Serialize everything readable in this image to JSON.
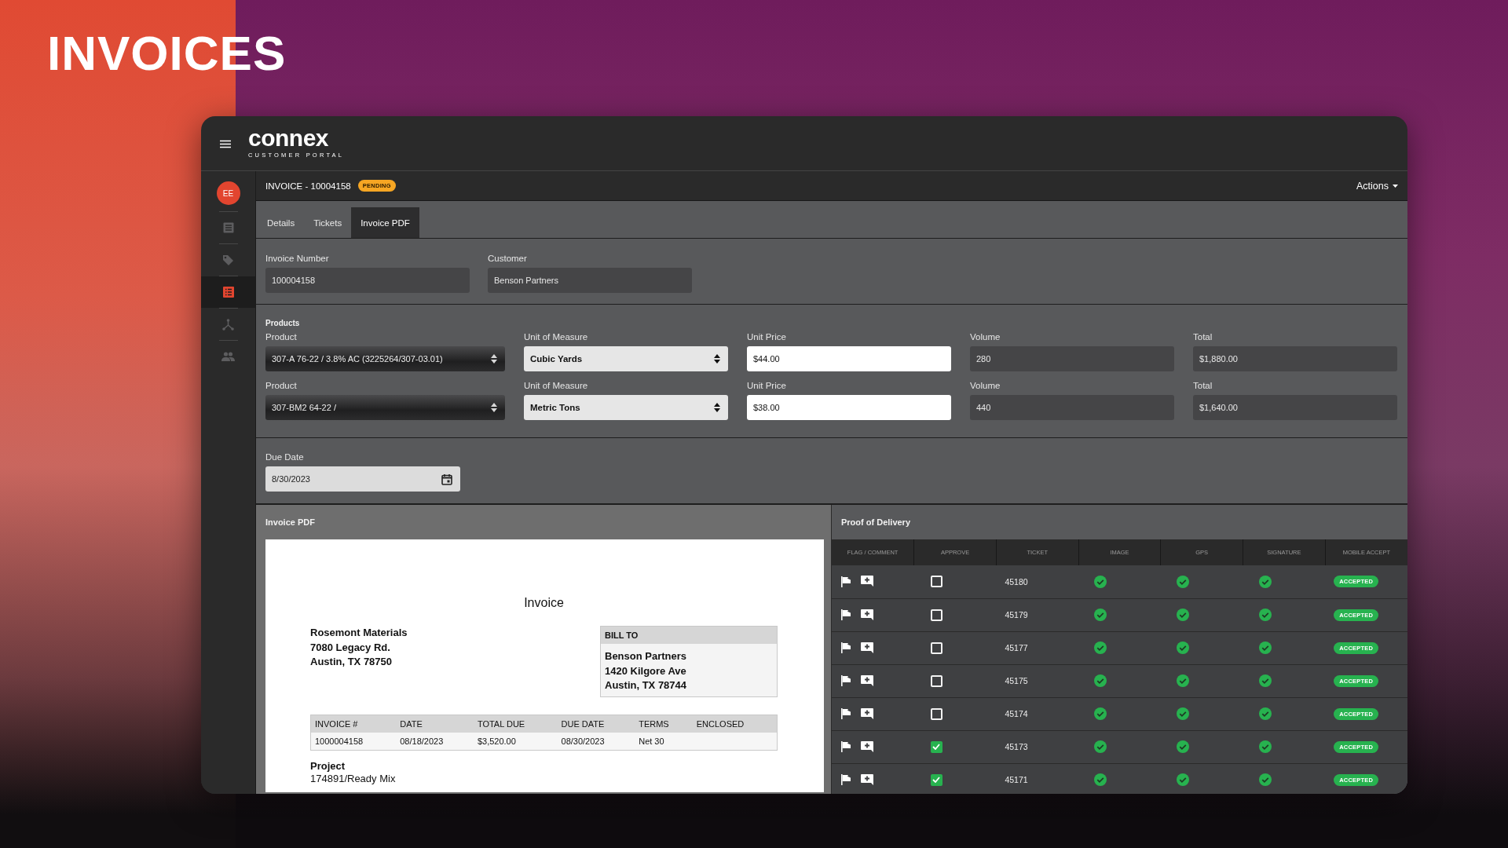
{
  "page_title": "INVOICES",
  "app": {
    "brand": "connex",
    "brand_subtitle": "CUSTOMER PORTAL"
  },
  "sidebar": {
    "avatar": "EE",
    "items": [
      {
        "kind": "document",
        "selected": false
      },
      {
        "kind": "tag",
        "selected": false
      },
      {
        "kind": "list",
        "selected": true
      },
      {
        "kind": "network",
        "selected": false
      },
      {
        "kind": "people",
        "selected": false
      }
    ]
  },
  "header": {
    "title": "INVOICE - 10004158",
    "status": "PENDING",
    "actions": "Actions"
  },
  "tabs": [
    {
      "label": "Details",
      "selected": false
    },
    {
      "label": "Tickets",
      "selected": false
    },
    {
      "label": "Invoice PDF",
      "selected": true
    }
  ],
  "invoice_number": {
    "label": "Invoice Number",
    "value": "100004158"
  },
  "customer": {
    "label": "Customer",
    "value": "Benson Partners"
  },
  "products": {
    "title": "Products",
    "rows": [
      {
        "product": {
          "label": "Product",
          "value": "307-A 76-22 / 3.8% AC (3225264/307-03.01)"
        },
        "unit": {
          "label": "Unit of Measure",
          "value": "Cubic Yards"
        },
        "unit_price": {
          "label": "Unit Price",
          "value": "$44.00"
        },
        "volume": {
          "label": "Volume",
          "value": "280"
        },
        "total": {
          "label": "Total",
          "value": "$1,880.00"
        }
      },
      {
        "product": {
          "label": "Product",
          "value": "307-BM2 64-22 /"
        },
        "unit": {
          "label": "Unit of Measure",
          "value": "Metric Tons"
        },
        "unit_price": {
          "label": "Unit Price",
          "value": "$38.00"
        },
        "volume": {
          "label": "Volume",
          "value": "440"
        },
        "total": {
          "label": "Total",
          "value": "$1,640.00"
        }
      }
    ]
  },
  "due_date": {
    "label": "Due Date",
    "value": "8/30/2023"
  },
  "invoice_pdf": {
    "title": "Invoice PDF",
    "document": {
      "heading": "Invoice",
      "from": [
        "Rosemont Materials",
        "7080 Legacy Rd.",
        "Austin, TX 78750"
      ],
      "bill_to": {
        "title": "BILL TO",
        "lines": [
          "Benson Partners",
          "1420 Kilgore Ave",
          "Austin, TX 78744"
        ]
      },
      "table": {
        "columns": [
          "INVOICE #",
          "DATE",
          "TOTAL DUE",
          "DUE DATE",
          "TERMS",
          "ENCLOSED"
        ],
        "rows": [
          [
            "1000004158",
            "08/18/2023",
            "$3,520.00",
            "08/30/2023",
            "Net 30",
            ""
          ]
        ]
      },
      "project": {
        "title": "Project",
        "value": "174891/Ready Mix"
      }
    }
  },
  "proof_of_delivery": {
    "title": "Proof of Delivery",
    "columns": [
      "FLAG / COMMENT",
      "APPROVE",
      "TICKET",
      "IMAGE",
      "GPS",
      "SIGNATURE",
      "MOBILE ACCEPT"
    ],
    "rows": [
      {
        "approved": false,
        "ticket": "45180",
        "image": true,
        "gps": true,
        "signature": true,
        "mobile_accept": "ACCEPTED"
      },
      {
        "approved": false,
        "ticket": "45179",
        "image": true,
        "gps": true,
        "signature": true,
        "mobile_accept": "ACCEPTED"
      },
      {
        "approved": false,
        "ticket": "45177",
        "image": true,
        "gps": true,
        "signature": true,
        "mobile_accept": "ACCEPTED"
      },
      {
        "approved": false,
        "ticket": "45175",
        "image": true,
        "gps": true,
        "signature": true,
        "mobile_accept": "ACCEPTED"
      },
      {
        "approved": false,
        "ticket": "45174",
        "image": true,
        "gps": true,
        "signature": true,
        "mobile_accept": "ACCEPTED"
      },
      {
        "approved": true,
        "ticket": "45173",
        "image": true,
        "gps": true,
        "signature": true,
        "mobile_accept": "ACCEPTED"
      },
      {
        "approved": true,
        "ticket": "45171",
        "image": true,
        "gps": true,
        "signature": true,
        "mobile_accept": "ACCEPTED"
      }
    ]
  }
}
